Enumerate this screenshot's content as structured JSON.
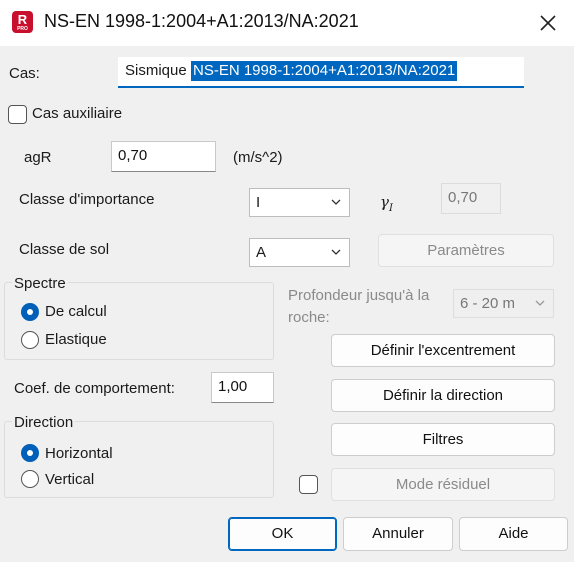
{
  "window": {
    "title": "NS-EN 1998-1:2004+A1:2013/NA:2021",
    "app_icon_letter": "R",
    "app_icon_sub": "PRO"
  },
  "cas": {
    "label": "Cas:",
    "value_plain": "Sismique",
    "value_selected": "NS-EN 1998-1:2004+A1:2013/NA:2021"
  },
  "cas_auxiliaire": {
    "label": "Cas auxiliaire",
    "checked": false
  },
  "agr": {
    "label": "agR",
    "value": "0,70",
    "unit": "(m/s^2)"
  },
  "importance": {
    "label": "Classe d'importance",
    "selected": "I",
    "gamma_symbol": "γ",
    "gamma_sub": "I",
    "gamma_value": "0,70"
  },
  "sol": {
    "label": "Classe de sol",
    "selected": "A",
    "params_button": "Paramètres"
  },
  "spectre": {
    "legend": "Spectre",
    "options": [
      "De calcul",
      "Elastique"
    ],
    "selected": "De calcul"
  },
  "profondeur": {
    "label_line1": "Profondeur jusqu'à la",
    "label_line2": "roche:",
    "selected": "6 - 20 m"
  },
  "buttons": {
    "excentrement": "Définir l'excentrement",
    "direction": "Définir la direction",
    "filtres": "Filtres",
    "mode_residuel": "Mode résiduel",
    "ok": "OK",
    "annuler": "Annuler",
    "aide": "Aide"
  },
  "coef": {
    "label": "Coef. de comportement:",
    "value": "1,00"
  },
  "direction": {
    "legend": "Direction",
    "options": [
      "Horizontal",
      "Vertical"
    ],
    "selected": "Horizontal"
  },
  "mode_residuel_checked": false,
  "colors": {
    "accent": "#005fb8",
    "selection": "#0067c0",
    "revit_red": "#c8102e"
  }
}
